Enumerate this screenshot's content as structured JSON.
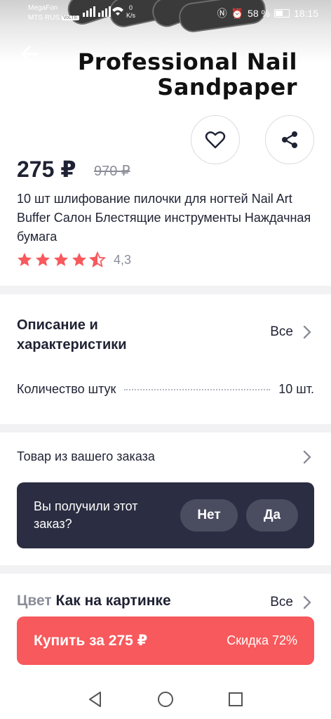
{
  "status_bar": {
    "carrier_1": "MegaFon",
    "carrier_2": "MTS RUS",
    "volte": "VoLTE",
    "speed_value": "0",
    "speed_unit": "K/s",
    "battery": "58 %",
    "time": "18:15"
  },
  "hero": {
    "line_1": "Professional Nail",
    "line_2": "Sandpaper"
  },
  "product": {
    "price": "275 ₽",
    "old_price": "970 ₽",
    "title": "10 шт шлифование пилочки для ногтей Nail Art Buffer Салон Блестящие инструменты Наждачная бумага",
    "rating": 4.3,
    "rating_text": "4,3"
  },
  "description": {
    "title": "Описание и характеристики",
    "all_label": "Все",
    "spec_name": "Количество штук",
    "spec_value": "10 шт."
  },
  "order": {
    "label": "Товар из вашего заказа",
    "question": "Вы получили этот заказ?",
    "no_label": "Нет",
    "yes_label": "Да"
  },
  "color": {
    "label": "Цвет",
    "value": "Как на картинке",
    "all_label": "Все"
  },
  "buy": {
    "label": "Купить за 275 ₽",
    "discount": "Скидка 72%"
  },
  "colors": {
    "accent": "#f7595c",
    "dark_card": "#2b2d42",
    "text": "#1f2233",
    "muted": "#8b8d99"
  }
}
